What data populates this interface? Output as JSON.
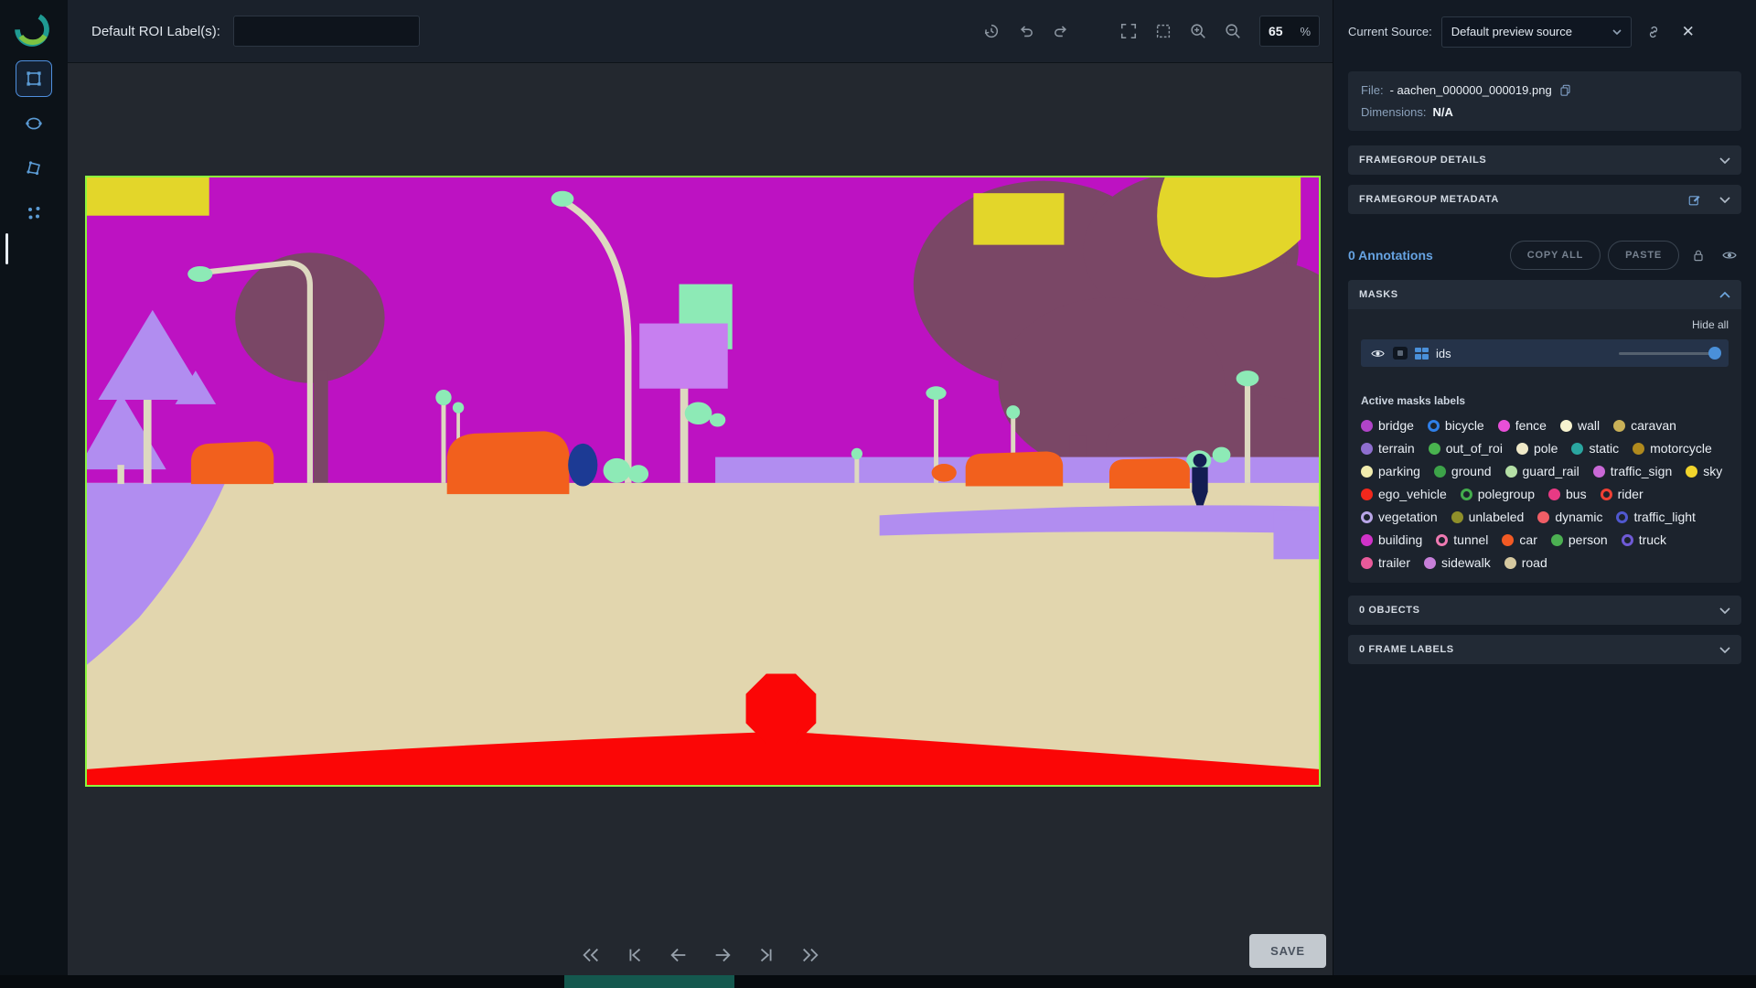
{
  "topbar": {
    "roi_label": "Default ROI Label(s):",
    "roi_value": "",
    "zoom": "65",
    "percent": "%"
  },
  "source": {
    "label": "Current Source:",
    "value": "Default preview source"
  },
  "file": {
    "label": "File:",
    "name": "- aachen_000000_000019.png",
    "dim_label": "Dimensions:",
    "dim_value": "N/A"
  },
  "panels": {
    "framegroup_details": "FRAMEGROUP DETAILS",
    "framegroup_metadata": "FRAMEGROUP METADATA",
    "objects": "0 OBJECTS",
    "frame_labels": "0 FRAME LABELS"
  },
  "annotations": {
    "count": "0 Annotations",
    "copy_all": "COPY ALL",
    "paste": "PASTE"
  },
  "masks": {
    "title": "MASKS",
    "hide_all": "Hide all",
    "ids": "ids",
    "active_title": "Active masks labels",
    "labels": [
      {
        "name": "bridge",
        "color": "#b044c8",
        "style": "solid"
      },
      {
        "name": "bicycle",
        "color": "#2f7fe8",
        "style": "ring"
      },
      {
        "name": "fence",
        "color": "#e84fd8",
        "style": "solid"
      },
      {
        "name": "wall",
        "color": "#f7f3cf",
        "style": "solid"
      },
      {
        "name": "caravan",
        "color": "#c9b158",
        "style": "solid"
      },
      {
        "name": "terrain",
        "color": "#8f6fd0",
        "style": "solid"
      },
      {
        "name": "out_of_roi",
        "color": "#49b34f",
        "style": "solid"
      },
      {
        "name": "pole",
        "color": "#efe9c8",
        "style": "solid"
      },
      {
        "name": "static",
        "color": "#2aa6a0",
        "style": "solid"
      },
      {
        "name": "motorcycle",
        "color": "#b08a1e",
        "style": "solid"
      },
      {
        "name": "parking",
        "color": "#f1ecae",
        "style": "solid"
      },
      {
        "name": "ground",
        "color": "#3da349",
        "style": "solid"
      },
      {
        "name": "guard_rail",
        "color": "#b5e0a6",
        "style": "solid"
      },
      {
        "name": "traffic_sign",
        "color": "#c968d6",
        "style": "solid"
      },
      {
        "name": "sky",
        "color": "#f2d52c",
        "style": "solid"
      },
      {
        "name": "ego_vehicle",
        "color": "#f2281c",
        "style": "solid"
      },
      {
        "name": "polegroup",
        "color": "#43ad4c",
        "style": "ring"
      },
      {
        "name": "bus",
        "color": "#e83a84",
        "style": "solid"
      },
      {
        "name": "rider",
        "color": "#ef4034",
        "style": "ring"
      },
      {
        "name": "vegetation",
        "color": "#b9a6e8",
        "style": "ring"
      },
      {
        "name": "unlabeled",
        "color": "#8f8f2a",
        "style": "solid"
      },
      {
        "name": "dynamic",
        "color": "#ef5e66",
        "style": "solid"
      },
      {
        "name": "traffic_light",
        "color": "#5058cf",
        "style": "ring"
      },
      {
        "name": "building",
        "color": "#d032c8",
        "style": "solid"
      },
      {
        "name": "tunnel",
        "color": "#ef7ab2",
        "style": "ring"
      },
      {
        "name": "car",
        "color": "#f25a24",
        "style": "solid"
      },
      {
        "name": "person",
        "color": "#4cb052",
        "style": "solid"
      },
      {
        "name": "truck",
        "color": "#6f5ad6",
        "style": "ring"
      },
      {
        "name": "trailer",
        "color": "#e85a9a",
        "style": "solid"
      },
      {
        "name": "sidewalk",
        "color": "#c77fd9",
        "style": "solid"
      },
      {
        "name": "road",
        "color": "#d6c9a0",
        "style": "solid"
      }
    ]
  },
  "transport": {
    "save": "SAVE"
  }
}
